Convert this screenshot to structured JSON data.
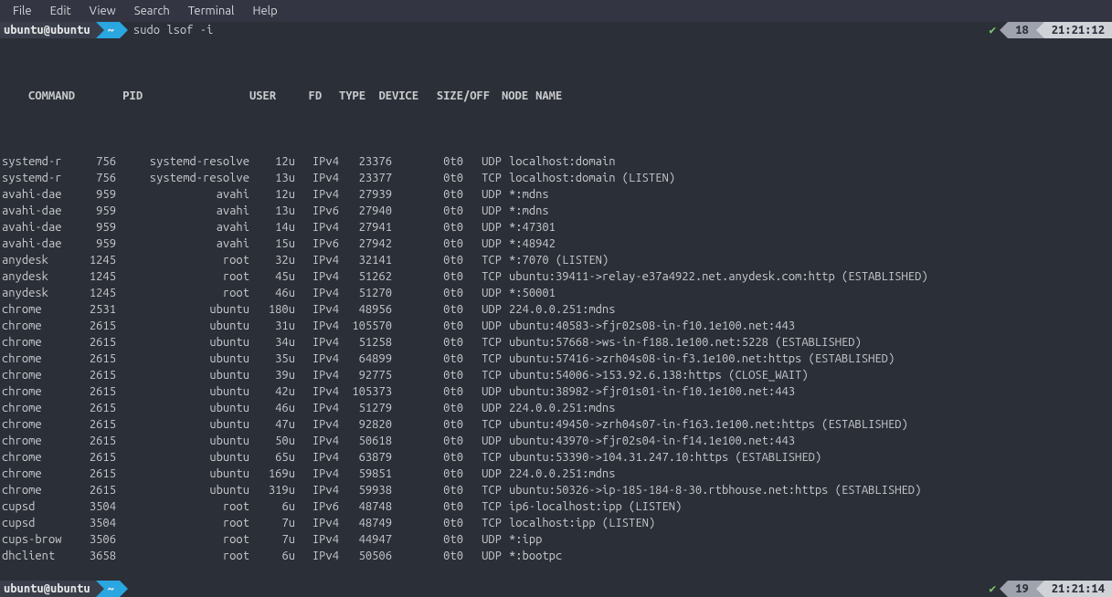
{
  "menubar": [
    "File",
    "Edit",
    "View",
    "Search",
    "Terminal",
    "Help"
  ],
  "prompt": {
    "user_host": "ubuntu@ubuntu",
    "path": "~",
    "command": "sudo lsof -i",
    "count1": "18",
    "time1": "21:21:12",
    "count2": "19",
    "time2": "21:21:14"
  },
  "headers": {
    "command": "COMMAND",
    "pid": "PID",
    "user": "USER",
    "fd": "FD",
    "type": "TYPE",
    "device": "DEVICE",
    "sizeoff": "SIZE/OFF",
    "node": "NODE",
    "name": "NAME"
  },
  "rows": [
    {
      "cmd": "systemd-r",
      "pid": "756",
      "user": "systemd-resolve",
      "fd": "12u",
      "type": "IPv4",
      "dev": "23376",
      "size": "0t0",
      "node": "UDP",
      "name": "localhost:domain"
    },
    {
      "cmd": "systemd-r",
      "pid": "756",
      "user": "systemd-resolve",
      "fd": "13u",
      "type": "IPv4",
      "dev": "23377",
      "size": "0t0",
      "node": "TCP",
      "name": "localhost:domain (LISTEN)"
    },
    {
      "cmd": "avahi-dae",
      "pid": "959",
      "user": "avahi",
      "fd": "12u",
      "type": "IPv4",
      "dev": "27939",
      "size": "0t0",
      "node": "UDP",
      "name": "*:mdns"
    },
    {
      "cmd": "avahi-dae",
      "pid": "959",
      "user": "avahi",
      "fd": "13u",
      "type": "IPv6",
      "dev": "27940",
      "size": "0t0",
      "node": "UDP",
      "name": "*:mdns"
    },
    {
      "cmd": "avahi-dae",
      "pid": "959",
      "user": "avahi",
      "fd": "14u",
      "type": "IPv4",
      "dev": "27941",
      "size": "0t0",
      "node": "UDP",
      "name": "*:47301"
    },
    {
      "cmd": "avahi-dae",
      "pid": "959",
      "user": "avahi",
      "fd": "15u",
      "type": "IPv6",
      "dev": "27942",
      "size": "0t0",
      "node": "UDP",
      "name": "*:48942"
    },
    {
      "cmd": "anydesk",
      "pid": "1245",
      "user": "root",
      "fd": "32u",
      "type": "IPv4",
      "dev": "32141",
      "size": "0t0",
      "node": "TCP",
      "name": "*:7070 (LISTEN)"
    },
    {
      "cmd": "anydesk",
      "pid": "1245",
      "user": "root",
      "fd": "45u",
      "type": "IPv4",
      "dev": "51262",
      "size": "0t0",
      "node": "TCP",
      "name": "ubuntu:39411->relay-e37a4922.net.anydesk.com:http (ESTABLISHED)"
    },
    {
      "cmd": "anydesk",
      "pid": "1245",
      "user": "root",
      "fd": "46u",
      "type": "IPv4",
      "dev": "51270",
      "size": "0t0",
      "node": "UDP",
      "name": "*:50001"
    },
    {
      "cmd": "chrome",
      "pid": "2531",
      "user": "ubuntu",
      "fd": "180u",
      "type": "IPv4",
      "dev": "48956",
      "size": "0t0",
      "node": "UDP",
      "name": "224.0.0.251:mdns"
    },
    {
      "cmd": "chrome",
      "pid": "2615",
      "user": "ubuntu",
      "fd": "31u",
      "type": "IPv4",
      "dev": "105570",
      "size": "0t0",
      "node": "UDP",
      "name": "ubuntu:40583->fjr02s08-in-f10.1e100.net:443"
    },
    {
      "cmd": "chrome",
      "pid": "2615",
      "user": "ubuntu",
      "fd": "34u",
      "type": "IPv4",
      "dev": "51258",
      "size": "0t0",
      "node": "TCP",
      "name": "ubuntu:57668->ws-in-f188.1e100.net:5228 (ESTABLISHED)"
    },
    {
      "cmd": "chrome",
      "pid": "2615",
      "user": "ubuntu",
      "fd": "35u",
      "type": "IPv4",
      "dev": "64899",
      "size": "0t0",
      "node": "TCP",
      "name": "ubuntu:57416->zrh04s08-in-f3.1e100.net:https (ESTABLISHED)"
    },
    {
      "cmd": "chrome",
      "pid": "2615",
      "user": "ubuntu",
      "fd": "39u",
      "type": "IPv4",
      "dev": "92775",
      "size": "0t0",
      "node": "TCP",
      "name": "ubuntu:54006->153.92.6.138:https (CLOSE_WAIT)"
    },
    {
      "cmd": "chrome",
      "pid": "2615",
      "user": "ubuntu",
      "fd": "42u",
      "type": "IPv4",
      "dev": "105373",
      "size": "0t0",
      "node": "UDP",
      "name": "ubuntu:38982->fjr01s01-in-f10.1e100.net:443"
    },
    {
      "cmd": "chrome",
      "pid": "2615",
      "user": "ubuntu",
      "fd": "46u",
      "type": "IPv4",
      "dev": "51279",
      "size": "0t0",
      "node": "UDP",
      "name": "224.0.0.251:mdns"
    },
    {
      "cmd": "chrome",
      "pid": "2615",
      "user": "ubuntu",
      "fd": "47u",
      "type": "IPv4",
      "dev": "92820",
      "size": "0t0",
      "node": "TCP",
      "name": "ubuntu:49450->zrh04s07-in-f163.1e100.net:https (ESTABLISHED)"
    },
    {
      "cmd": "chrome",
      "pid": "2615",
      "user": "ubuntu",
      "fd": "50u",
      "type": "IPv4",
      "dev": "50618",
      "size": "0t0",
      "node": "UDP",
      "name": "ubuntu:43970->fjr02s04-in-f14.1e100.net:443"
    },
    {
      "cmd": "chrome",
      "pid": "2615",
      "user": "ubuntu",
      "fd": "65u",
      "type": "IPv4",
      "dev": "63879",
      "size": "0t0",
      "node": "TCP",
      "name": "ubuntu:53390->104.31.247.10:https (ESTABLISHED)"
    },
    {
      "cmd": "chrome",
      "pid": "2615",
      "user": "ubuntu",
      "fd": "169u",
      "type": "IPv4",
      "dev": "59851",
      "size": "0t0",
      "node": "UDP",
      "name": "224.0.0.251:mdns"
    },
    {
      "cmd": "chrome",
      "pid": "2615",
      "user": "ubuntu",
      "fd": "319u",
      "type": "IPv4",
      "dev": "59938",
      "size": "0t0",
      "node": "TCP",
      "name": "ubuntu:50326->ip-185-184-8-30.rtbhouse.net:https (ESTABLISHED)"
    },
    {
      "cmd": "cupsd",
      "pid": "3504",
      "user": "root",
      "fd": "6u",
      "type": "IPv6",
      "dev": "48748",
      "size": "0t0",
      "node": "TCP",
      "name": "ip6-localhost:ipp (LISTEN)"
    },
    {
      "cmd": "cupsd",
      "pid": "3504",
      "user": "root",
      "fd": "7u",
      "type": "IPv4",
      "dev": "48749",
      "size": "0t0",
      "node": "TCP",
      "name": "localhost:ipp (LISTEN)"
    },
    {
      "cmd": "cups-brow",
      "pid": "3506",
      "user": "root",
      "fd": "7u",
      "type": "IPv4",
      "dev": "44947",
      "size": "0t0",
      "node": "UDP",
      "name": "*:ipp"
    },
    {
      "cmd": "dhclient",
      "pid": "3658",
      "user": "root",
      "fd": "6u",
      "type": "IPv4",
      "dev": "50506",
      "size": "0t0",
      "node": "UDP",
      "name": "*:bootpc"
    }
  ]
}
